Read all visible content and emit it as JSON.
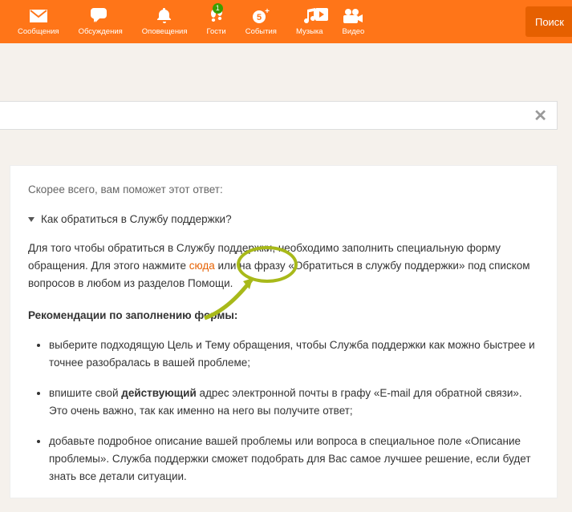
{
  "nav": {
    "items": [
      {
        "label": "Сообщения"
      },
      {
        "label": "Обсуждения"
      },
      {
        "label": "Оповещения"
      },
      {
        "label": "Гости",
        "badge": "1"
      },
      {
        "label": "События"
      },
      {
        "label": "Музыка"
      },
      {
        "label": "Видео"
      }
    ],
    "search": "Поиск"
  },
  "help": {
    "hint": "Скорее всего, вам поможет этот ответ:",
    "question": "Как обратиться в Службу поддержки?",
    "p1a": "Для того чтобы обратиться в Службу поддержки, необходимо заполнить специальную форму обращения. Для этого нажмите ",
    "link_here": "сюда",
    "p1b": " или на фразу «Обратиться в службу поддержки» под списком вопросов в любом из разделов Помощи.",
    "rec_title": "Рекомендации по заполнению формы",
    "li1": "выберите подходящую Цель и Тему обращения, чтобы Служба поддержки как можно быстрее и точнее разобралась в вашей проблеме;",
    "li2a": "впишите свой ",
    "li2b": "действующий",
    "li2c": " адрес электронной почты в графу «E-mail для обратной связи». Это очень важно, так как именно на него вы получите ответ;",
    "li3": "добавьте подробное описание вашей проблемы или вопроса в специальное поле «Описание проблемы». Служба поддержки сможет подобрать для Вас самое лучшее решение, если будет знать все детали ситуации."
  }
}
